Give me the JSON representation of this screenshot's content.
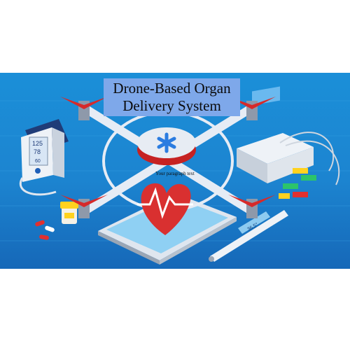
{
  "title": {
    "line1": "Drone-Based Organ",
    "line2": "Delivery System"
  },
  "caption": "Your paragraph text",
  "bp_monitor": {
    "top_value": "125",
    "bottom_value": "78",
    "pulse": "60"
  },
  "thermometer_reading": "36.5°",
  "colors": {
    "background": "#1b8fd8",
    "title_box": "#7ea8ea",
    "propeller": "#d62a2a",
    "drone_frame": "#e6ecf5",
    "heart": "#d93030",
    "medical_cross": "#2b7ce0"
  },
  "icons": [
    "drone",
    "medical-cross-icon",
    "heart-pulse-icon",
    "blood-pressure-monitor",
    "pill-bottle",
    "capsules",
    "tablet-device",
    "thermometer",
    "ecg-machine",
    "color-cables"
  ]
}
